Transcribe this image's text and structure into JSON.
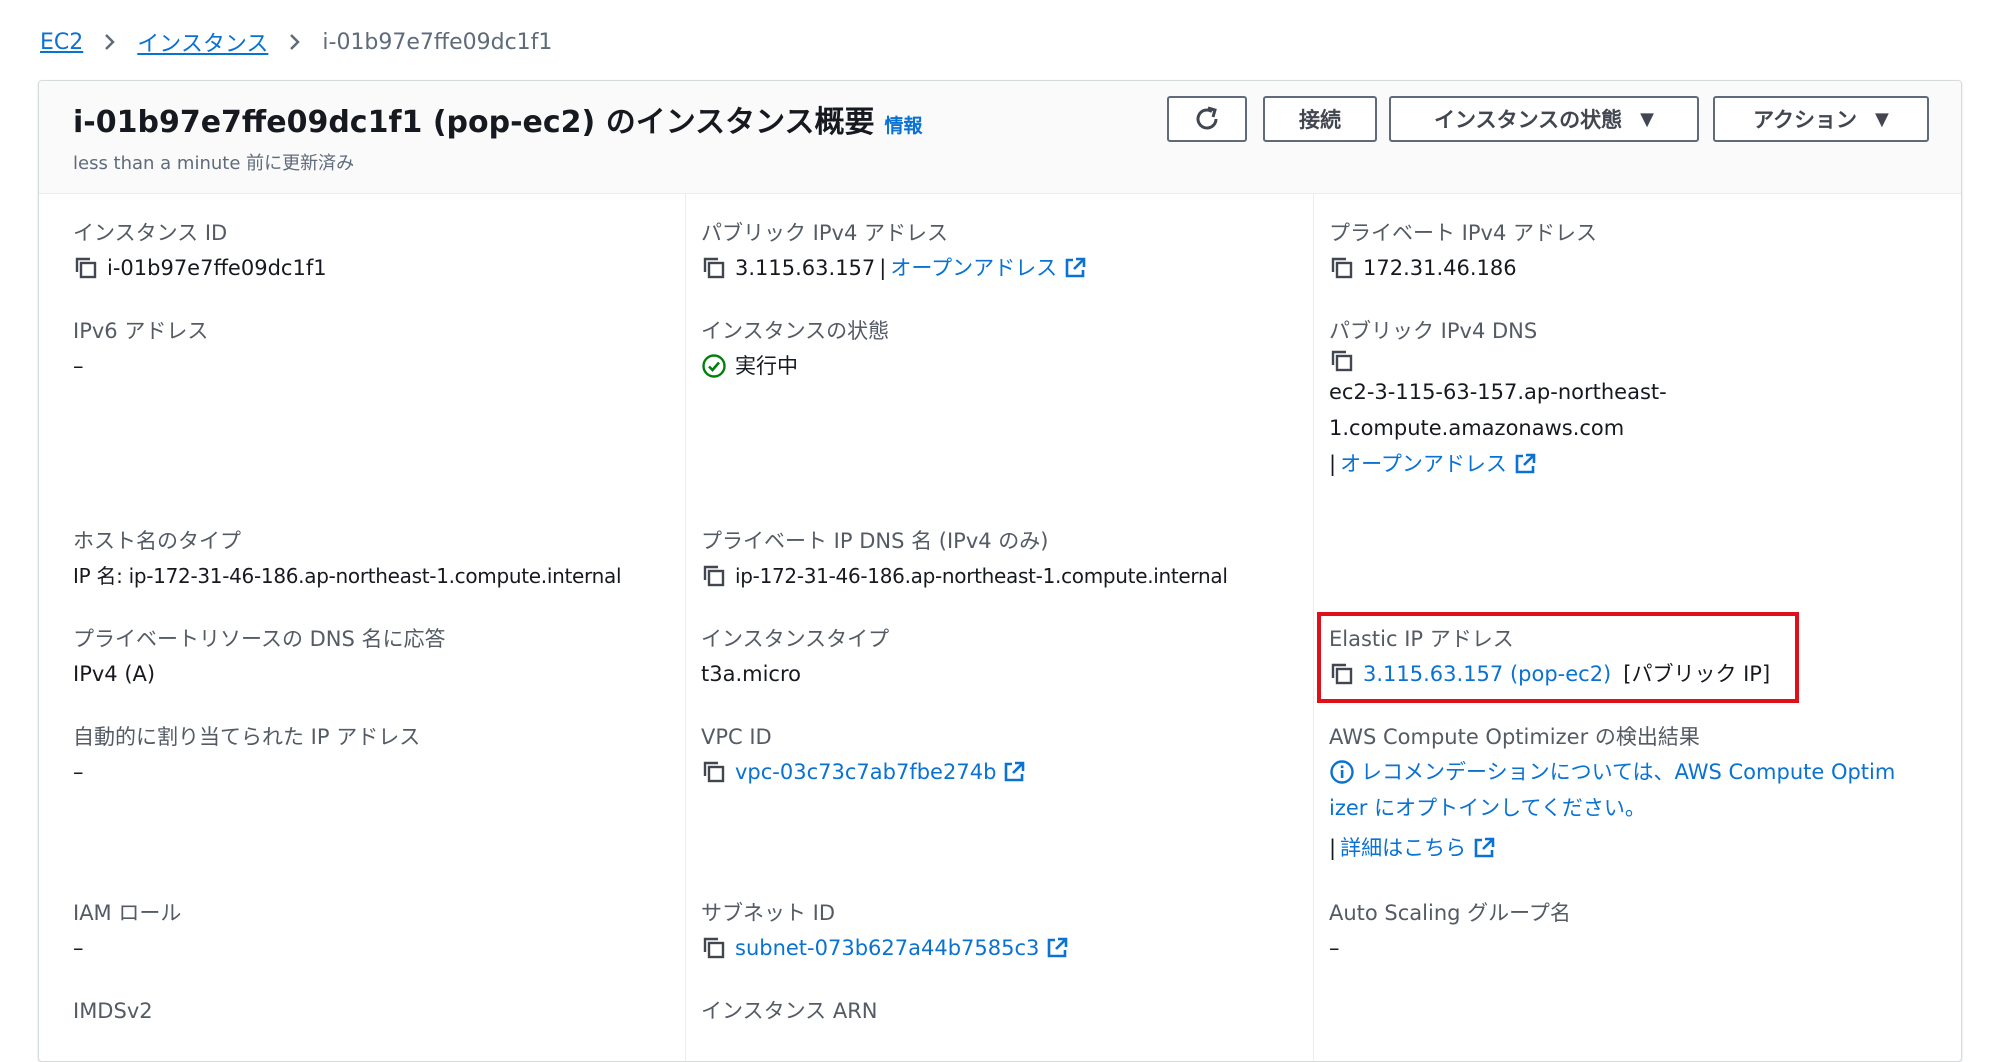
{
  "breadcrumb": {
    "items": [
      "EC2",
      "インスタンス"
    ],
    "current": "i-01b97e7ffe09dc1f1"
  },
  "header": {
    "title": "i-01b97e7ffe09dc1f1 (pop-ec2) のインスタンス概要",
    "info": "情報",
    "updated": "less than a minute 前に更新済み",
    "buttons": {
      "refresh": "refresh-icon",
      "connect": "接続",
      "instance_state": "インスタンスの状態",
      "actions": "アクション"
    }
  },
  "fields": {
    "instance_id": {
      "label": "インスタンス ID",
      "value": "i-01b97e7ffe09dc1f1"
    },
    "public_ipv4": {
      "label": "パブリック IPv4 アドレス",
      "value": "3.115.63.157",
      "open": "オープンアドレス"
    },
    "private_ipv4": {
      "label": "プライベート IPv4 アドレス",
      "value": "172.31.46.186"
    },
    "ipv6": {
      "label": "IPv6 アドレス",
      "value": "–"
    },
    "instance_state": {
      "label": "インスタンスの状態",
      "value": "実行中"
    },
    "public_dns": {
      "label": "パブリック IPv4 DNS",
      "line1": "ec2-3-115-63-157.ap-northeast-",
      "line2": "1.compute.amazonaws.com",
      "open": "オープンアドレス"
    },
    "hostname_type": {
      "label": "ホスト名のタイプ",
      "value": "IP 名: ip-172-31-46-186.ap-northeast-1.compute.internal"
    },
    "private_dns": {
      "label": "プライベート IP DNS 名 (IPv4 のみ)",
      "value": "ip-172-31-46-186.ap-northeast-1.compute.internal"
    },
    "resource_dns": {
      "label": "プライベートリソースの DNS 名に応答",
      "value": "IPv4 (A)"
    },
    "instance_type": {
      "label": "インスタンスタイプ",
      "value": "t3a.micro"
    },
    "elastic_ip": {
      "label": "Elastic IP アドレス",
      "value": "3.115.63.157 (pop-ec2)",
      "suffix": "[パブリック IP]"
    },
    "auto_ip": {
      "label": "自動的に割り当てられた IP アドレス",
      "value": "–"
    },
    "vpc_id": {
      "label": "VPC ID",
      "value": "vpc-03c73c7ab7fbe274b"
    },
    "optimizer": {
      "label": "AWS Compute Optimizer の検出結果",
      "line1": "レコメンデーションについては、AWS Compute Optim",
      "line2": "izer にオプトインしてください。",
      "more": "詳細はこちら"
    },
    "iam_role": {
      "label": "IAM ロール",
      "value": "–"
    },
    "subnet_id": {
      "label": "サブネット ID",
      "value": "subnet-073b627a44b7585c3"
    },
    "asg": {
      "label": "Auto Scaling グループ名",
      "value": "–"
    },
    "imdsv2": {
      "label": "IMDSv2"
    },
    "arn": {
      "label": "インスタンス ARN"
    }
  },
  "colors": {
    "link": "#0972d3",
    "success": "#037f0c",
    "highlight": "#e0101a"
  }
}
